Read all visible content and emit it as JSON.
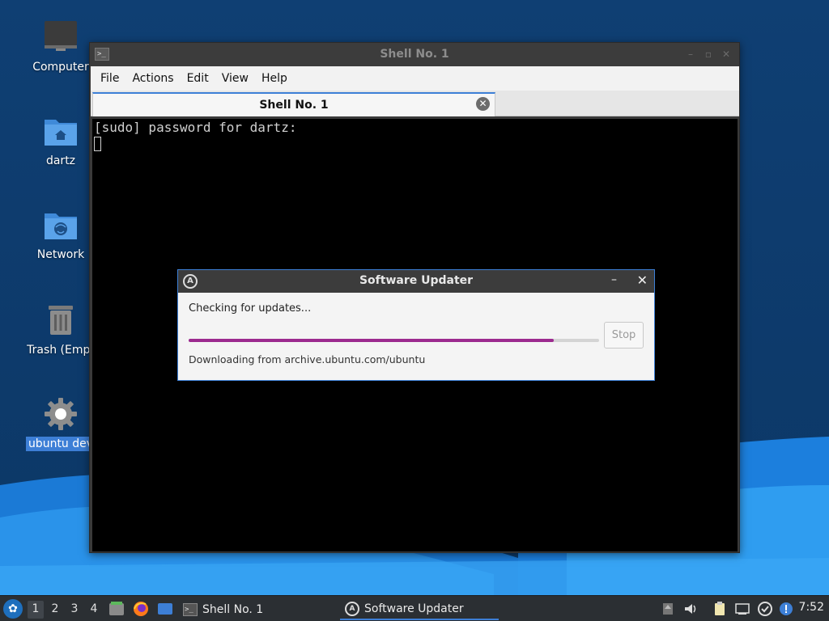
{
  "desktop": {
    "icons": [
      {
        "label": "Computer",
        "icon": "computer-icon"
      },
      {
        "label": "dartz",
        "icon": "home-folder-icon"
      },
      {
        "label": "Network",
        "icon": "network-folder-icon"
      },
      {
        "label": "Trash (Empt",
        "icon": "trash-icon"
      },
      {
        "label": "ubuntu dev",
        "icon": "settings-gear-icon",
        "selected": true
      }
    ]
  },
  "terminal": {
    "title": "Shell No. 1",
    "menu": [
      "File",
      "Actions",
      "Edit",
      "View",
      "Help"
    ],
    "tab_label": "Shell No. 1",
    "lines": [
      "[sudo] password for dartz:"
    ]
  },
  "updater": {
    "title": "Software Updater",
    "status": "Checking for updates...",
    "progress": 0.89,
    "stop_label": "Stop",
    "source": "Downloading from archive.ubuntu.com/ubuntu",
    "minimize_glyph": "–",
    "close_glyph": "✕"
  },
  "taskbar": {
    "workspaces": [
      "1",
      "2",
      "3",
      "4"
    ],
    "active_workspace": "1",
    "tasks": [
      {
        "label": "Shell No. 1",
        "icon": "terminal-icon"
      },
      {
        "label": "Software Updater",
        "icon": "updater-icon",
        "active": true
      }
    ],
    "clock": "7:52"
  },
  "colors": {
    "accent": "#3d7fd6",
    "progress": "#9c2a8f",
    "desktop_bg": "#0f3f73",
    "taskbar_bg": "#2b2f33"
  }
}
